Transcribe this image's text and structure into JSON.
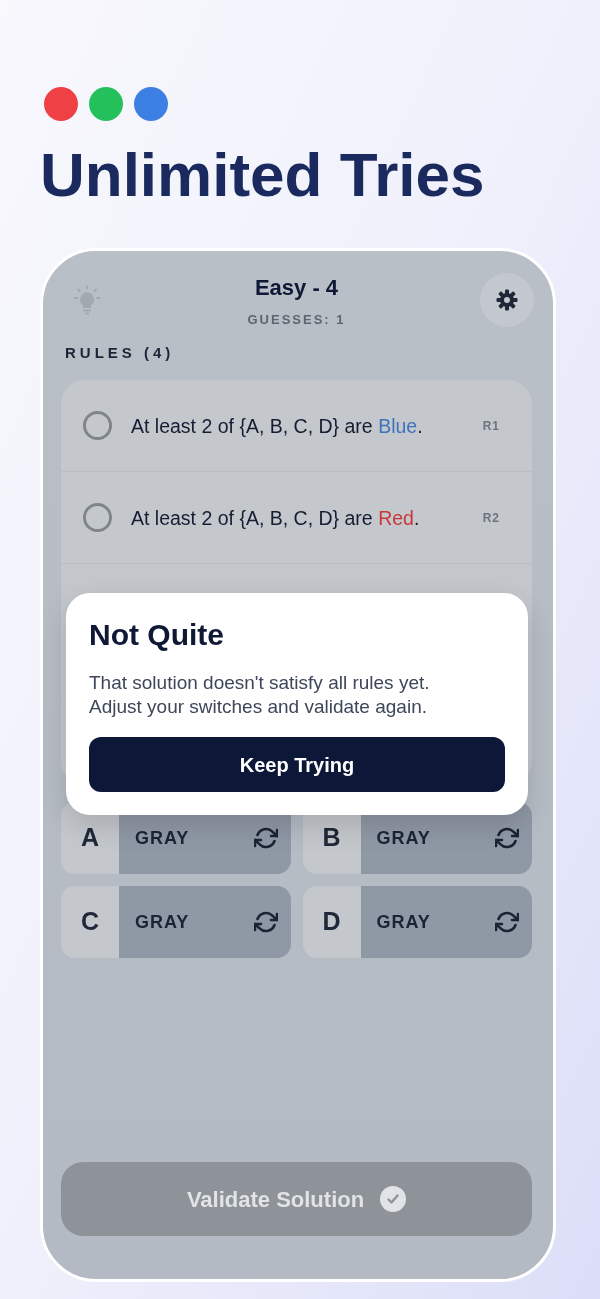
{
  "dots": [
    {
      "color": "#ee4045"
    },
    {
      "color": "#24c05b"
    },
    {
      "color": "#3d80e3"
    }
  ],
  "headline": "Unlimited Tries",
  "screen": {
    "title": "Easy - 4",
    "guesses": "GUESSES: 1",
    "rules_heading": "RULES (4)",
    "rules": [
      {
        "checked": false,
        "before": "At least 2 of {A, B, C, D} are ",
        "word": "Blue",
        "color": "#3f72bd",
        "after": ".",
        "tag": "R1"
      },
      {
        "checked": false,
        "before": "At least 2 of {A, B, C, D} are ",
        "word": "Red",
        "color": "#c8373a",
        "after": ".",
        "tag": "R2"
      }
    ],
    "switches": [
      {
        "letter": "A",
        "value": "GRAY"
      },
      {
        "letter": "B",
        "value": "GRAY"
      },
      {
        "letter": "C",
        "value": "GRAY"
      },
      {
        "letter": "D",
        "value": "GRAY"
      }
    ],
    "validate_button": {
      "label": "Validate Solution",
      "disabled": true
    }
  },
  "dialog": {
    "title": "Not Quite",
    "message": "That solution doesn't satisfy all rules yet. Adjust your switches and validate again.",
    "button": "Keep Trying"
  }
}
